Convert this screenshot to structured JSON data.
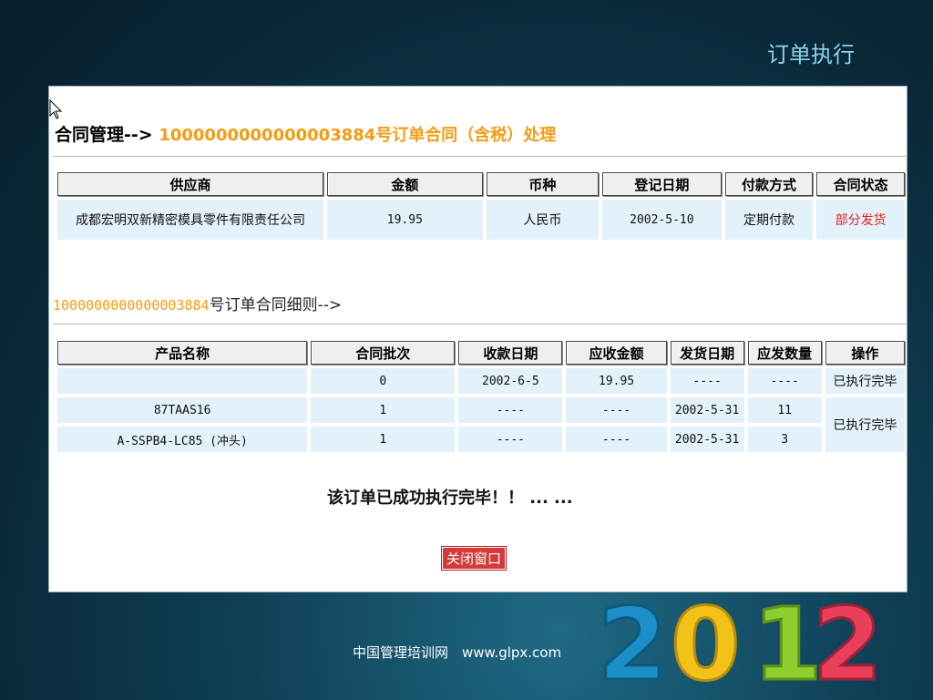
{
  "slide": {
    "title": "订单执行",
    "footer": "中国管理培训网　www.glpx.com",
    "deco_number": "2012"
  },
  "contract": {
    "heading_prefix": "合同管理-->",
    "heading_order": "1000000000000003884号订单合同（含税）处理",
    "columns": [
      "供应商",
      "金额",
      "币种",
      "登记日期",
      "付款方式",
      "合同状态"
    ],
    "row": {
      "supplier": "成都宏明双新精密模具零件有限责任公司",
      "amount": "19.95",
      "currency": "人民币",
      "date": "2002-5-10",
      "payment": "定期付款",
      "status": "部分发货"
    }
  },
  "details": {
    "order_no": "1000000000000003884",
    "title_suffix": "号订单合同细则-->",
    "columns": [
      "产品名称",
      "合同批次",
      "收款日期",
      "应收金额",
      "发货日期",
      "应发数量",
      "操作"
    ],
    "rows": [
      {
        "product": "",
        "batch": "0",
        "pay_date": "2002-6-5",
        "amount": "19.95",
        "ship_date": "----",
        "qty": "----",
        "op": "已执行完毕"
      },
      {
        "product": "87TAAS16",
        "batch": "1",
        "pay_date": "----",
        "amount": "----",
        "ship_date": "2002-5-31",
        "qty": "11",
        "op": "已执行完毕"
      },
      {
        "product": "A-SSPB4-LC85 (冲头)",
        "batch": "1",
        "pay_date": "----",
        "amount": "----",
        "ship_date": "2002-5-31",
        "qty": "3",
        "op": ""
      }
    ]
  },
  "message": "该订单已成功执行完毕！！ ... ...",
  "close_button": "关闭窗口",
  "colors": {
    "accent_orange": "#f39c12",
    "status_red": "#e02020",
    "header_text": "#8fd3ea"
  }
}
